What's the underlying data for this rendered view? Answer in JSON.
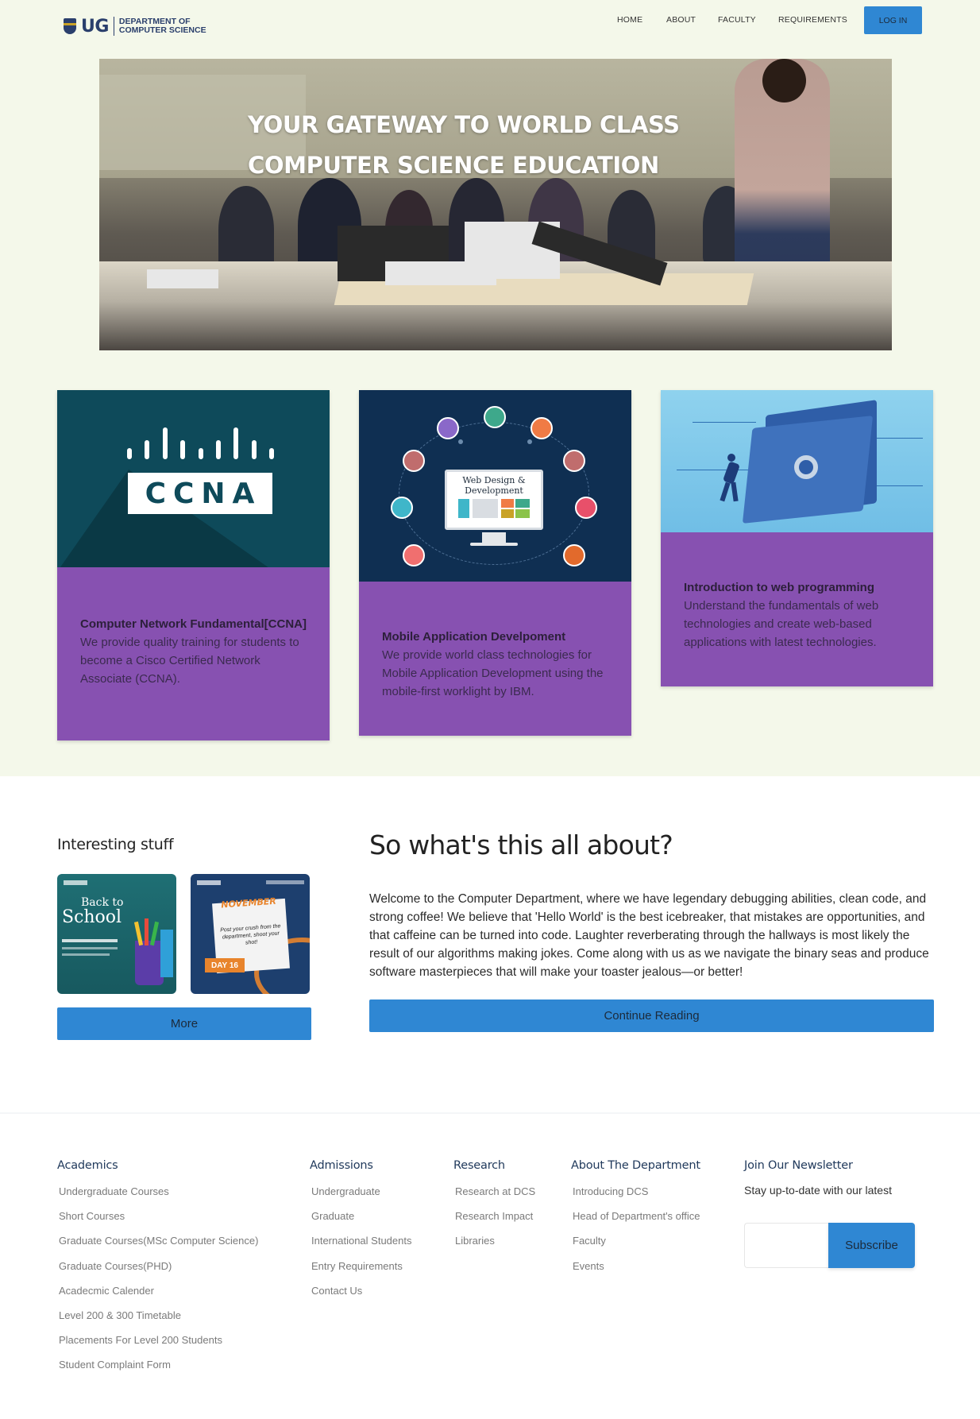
{
  "header": {
    "logo_ug": "UG",
    "logo_line1": "DEPARTMENT OF",
    "logo_line2": "COMPUTER SCIENCE",
    "nav": [
      "HOME",
      "ABOUT",
      "FACULTY",
      "REQUIREMENTS"
    ],
    "login_label": "LOG IN"
  },
  "hero": {
    "title_line1": "YOUR GATEWAY TO WORLD CLASS",
    "title_line2": "COMPUTER SCIENCE EDUCATION"
  },
  "cards": [
    {
      "image_label": "CCNA",
      "title": "Computer Network Fundamental[CCNA]",
      "description": "We provide quality training for students to become a Cisco Certified Network Associate (CCNA)."
    },
    {
      "image_label_line1": "Web Design &",
      "image_label_line2": "Development",
      "title": "Mobile Application Develpoment",
      "description": "We provide world class technologies for Mobile Application Development using the mobile-first worklight by IBM."
    },
    {
      "title": "Introduction to web programming",
      "description": "Understand the fundamentals of web technologies and create web-based applications with latest technologies."
    }
  ],
  "stuff": {
    "heading": "Interesting stuff",
    "thumb1_text1": "Back to",
    "thumb1_text2": "School",
    "thumb2_text1": "NOVEMBER",
    "thumb2_text2": "Post your crush from the department, shoot your shot!",
    "thumb2_text3": "DAY 16",
    "more_label": "More"
  },
  "about": {
    "heading": "So what's this all about?",
    "text": "Welcome to the Computer Department, where we have legendary debugging abilities, clean code, and strong coffee! We believe that 'Hello World' is the best icebreaker, that mistakes are opportunities, and that caffeine can be turned into code. Laughter reverberating through the hallways is most likely the result of our algorithms making jokes. Come along with us as we navigate the binary seas and produce software masterpieces that will make your toaster jealous—or better!",
    "continue_label": "Continue Reading"
  },
  "footer": {
    "academics": {
      "heading": "Academics",
      "items": [
        "Undergraduate Courses",
        "Short Courses",
        "Graduate Courses(MSc Computer Science)",
        "Graduate Courses(PHD)",
        "Acadecmic Calender",
        "Level 200 & 300 Timetable",
        "Placements For Level 200 Students",
        "Student Complaint Form"
      ]
    },
    "admissions": {
      "heading": "Admissions",
      "items": [
        "Undergraduate",
        "Graduate",
        "International Students",
        "Entry Requirements",
        "Contact Us"
      ]
    },
    "research": {
      "heading": "Research",
      "items": [
        "Research at DCS",
        "Research Impact",
        "Libraries"
      ]
    },
    "department": {
      "heading": "About The Department",
      "items": [
        "Introducing DCS",
        "Head of Department's office",
        "Faculty",
        "Events"
      ]
    },
    "newsletter": {
      "heading": "Join Our Newsletter",
      "subtext": "Stay up-to-date with our latest",
      "input_placeholder": "",
      "subscribe_label": "Subscribe"
    }
  },
  "colors": {
    "accent_blue": "#2f87d3",
    "card_purple": "#8751b1",
    "top_background": "#f4f8ea",
    "footer_heading": "#213a5c"
  }
}
